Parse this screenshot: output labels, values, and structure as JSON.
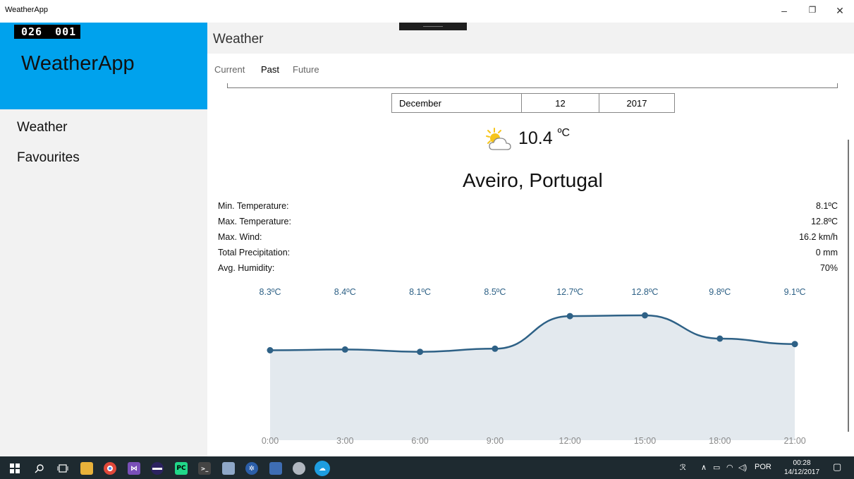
{
  "window": {
    "title": "WeatherApp",
    "controls": {
      "minimize": "–",
      "restore": "❐",
      "close": "✕"
    }
  },
  "sidebar": {
    "counter": "026 001",
    "app_name": "WeatherApp",
    "accent": "#00a2ed",
    "items": [
      {
        "label": "Weather"
      },
      {
        "label": "Favourites"
      }
    ]
  },
  "page": {
    "title": "Weather",
    "tabs": [
      {
        "label": "Current",
        "active": false
      },
      {
        "label": "Past",
        "active": true
      },
      {
        "label": "Future",
        "active": false
      }
    ]
  },
  "date_picker": {
    "month": "December",
    "day": "12",
    "year": "2017"
  },
  "current": {
    "icon": "partly-sunny-icon",
    "temperature": "10.4",
    "unit": "ºC",
    "location": "Aveiro, Portugal"
  },
  "stats": [
    {
      "label": "Min. Temperature:",
      "value": "8.1ºC"
    },
    {
      "label": "Max. Temperature:",
      "value": "12.8ºC"
    },
    {
      "label": "Max. Wind:",
      "value": "16.2 km/h"
    },
    {
      "label": "Total Precipitation:",
      "value": "0 mm"
    },
    {
      "label": "Avg. Humidity:",
      "value": "70%"
    }
  ],
  "chart_data": {
    "type": "area",
    "categories": [
      "0:00",
      "3:00",
      "6:00",
      "9:00",
      "12:00",
      "15:00",
      "18:00",
      "21:00"
    ],
    "values": [
      8.3,
      8.4,
      8.1,
      8.5,
      12.7,
      12.8,
      9.8,
      9.1
    ],
    "data_labels": [
      "8.3ºC",
      "8.4ºC",
      "8.1ºC",
      "8.5ºC",
      "12.7ºC",
      "12.8ºC",
      "9.8ºC",
      "9.1ºC"
    ],
    "line_color": "#2e6186",
    "fill_color": "#e3e9ee",
    "label_color": "#2e6186"
  },
  "taskbar": {
    "icons": [
      "windows-start-icon",
      "search-icon",
      "task-view-icon",
      "file-explorer-icon",
      "chrome-icon",
      "visual-studio-icon",
      "eclipse-icon",
      "pycharm-icon",
      "terminal-icon",
      "paint-icon",
      "network-app-icon",
      "python-app-icon",
      "paint-palette-icon",
      "weather-app-icon"
    ],
    "tray": {
      "language": "POR",
      "time": "00:28",
      "date": "14/12/2017"
    }
  }
}
